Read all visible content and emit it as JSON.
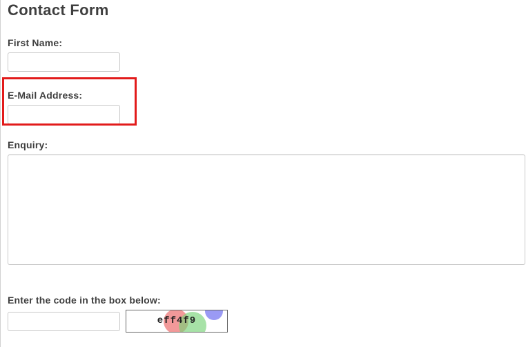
{
  "page": {
    "title": "Contact Form"
  },
  "form": {
    "firstName": {
      "label": "First Name:",
      "value": ""
    },
    "email": {
      "label": "E-Mail Address:",
      "value": ""
    },
    "enquiry": {
      "label": "Enquiry:",
      "value": ""
    },
    "captcha": {
      "label": "Enter the code in the box below:",
      "value": "",
      "code": "eff4f9"
    }
  }
}
